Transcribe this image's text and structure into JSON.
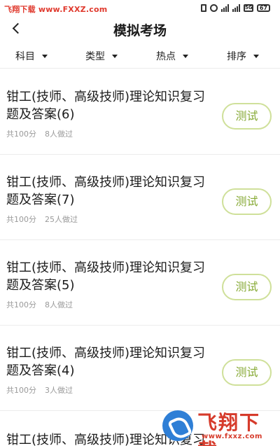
{
  "status_bar": {
    "watermark": "飞翔下载 www.FXXZ.com",
    "battery": "67",
    "wifi": "5G",
    "icons": [
      "vibrate-icon",
      "alarm-icon",
      "signal-icon",
      "signal-icon",
      "wifi-icon",
      "battery-icon"
    ]
  },
  "header": {
    "title": "模拟考场",
    "back_icon": "back-arrow-icon"
  },
  "filters": [
    {
      "label": "科目"
    },
    {
      "label": "类型"
    },
    {
      "label": "热点"
    },
    {
      "label": "排序"
    }
  ],
  "exams": [
    {
      "title": "钳工(技师、高级技师)理论知识复习题及答案(6)",
      "score": "共100分",
      "takers": "8人做过",
      "action": "测试"
    },
    {
      "title": "钳工(技师、高级技师)理论知识复习题及答案(7)",
      "score": "共100分",
      "takers": "25人做过",
      "action": "测试"
    },
    {
      "title": "钳工(技师、高级技师)理论知识复习题及答案(5)",
      "score": "共100分",
      "takers": "8人做过",
      "action": "测试"
    },
    {
      "title": "钳工(技师、高级技师)理论知识复习题及答案(4)",
      "score": "共100分",
      "takers": "3人做过",
      "action": "测试"
    },
    {
      "title": "钳工(技师、高级技师)理论知识复习",
      "score": "",
      "takers": "",
      "action": ""
    }
  ],
  "logo": {
    "name": "飞翔下载",
    "url": "www.fxxz.com"
  },
  "colors": {
    "accent_green": "#86a934",
    "button_border": "#cfe09a",
    "watermark_red": "#e03a2e"
  }
}
